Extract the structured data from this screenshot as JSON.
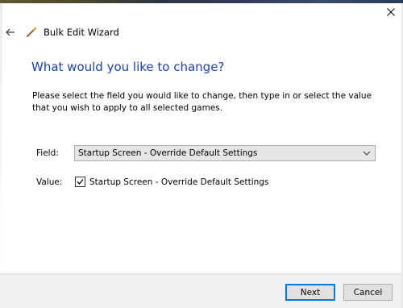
{
  "window": {
    "title": "Bulk Edit Wizard",
    "close_icon": "close-icon",
    "back_icon": "back-arrow-icon",
    "title_icon": "wand-icon"
  },
  "page": {
    "heading": "What would you like to change?",
    "instructions": "Please select the field you would like to change, then type in or select the value that you wish to apply to all selected games."
  },
  "form": {
    "field_label": "Field:",
    "field_value": "Startup Screen - Override Default Settings",
    "value_label": "Value:",
    "value_checkbox_label": "Startup Screen - Override Default Settings",
    "value_checked": true
  },
  "footer": {
    "next_label": "Next",
    "cancel_label": "Cancel"
  },
  "colors": {
    "heading": "#1e3faa",
    "primary_button_border": "#0078d7",
    "footer_background": "#f0f0f0"
  }
}
